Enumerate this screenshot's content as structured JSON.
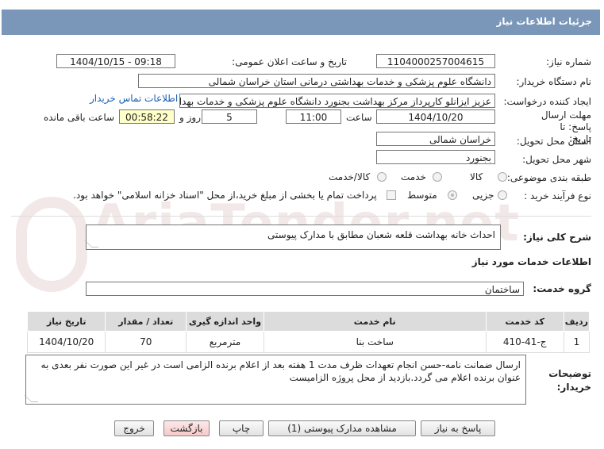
{
  "header": {
    "title": "جزئیات اطلاعات نیاز"
  },
  "fields": {
    "need_number_label": "شماره نیاز:",
    "need_number": "1104000257004615",
    "announce_label": "تاریخ و ساعت اعلان عمومی:",
    "announce_value": "1404/10/15 - 09:18",
    "buyer_label": "نام دستگاه خریدار:",
    "buyer_value": "دانشگاه علوم پزشکی و خدمات بهداشتی درمانی استان خراسان شمالی",
    "creator_label": "ایجاد کننده درخواست:",
    "creator_value": "عزیز ایزانلو کارپرداز مرکز بهداشت بجنورد دانشگاه علوم پزشکی و خدمات بهداشتی",
    "contact_link": "اطلاعات تماس خریدار",
    "deadline_label": "مهلت ارسال پاسخ: تا تاریخ:",
    "deadline_date": "1404/10/20",
    "time_label": "ساعت",
    "deadline_time": "11:00",
    "days_value": "5",
    "days_label": "روز و",
    "remaining_value": "00:58:22",
    "remaining_label": "ساعت باقی مانده",
    "province_label": "استان محل تحویل:",
    "province_value": "خراسان شمالی",
    "city_label": "شهر محل تحویل:",
    "city_value": "بجنورد",
    "category_label": "طبقه بندی موضوعی:",
    "category_options": [
      "کالا",
      "خدمت",
      "کالا/خدمت"
    ],
    "process_label": "نوع فرآیند خرید :",
    "process_options": [
      "جزیی",
      "متوسط"
    ],
    "payment_note": "پرداخت تمام یا بخشی از مبلغ خرید،از محل \"اسناد خزانه اسلامی\" خواهد بود."
  },
  "summary": {
    "label": "شرح کلی نیاز:",
    "value": "احداث خانه بهداشت قلعه شعبان مطابق با مدارک پیوستی"
  },
  "services_title": "اطلاعات خدمات مورد نیاز",
  "service_group": {
    "label": "گروه خدمت:",
    "value": "ساختمان"
  },
  "watermark": "AriaTender.net",
  "table": {
    "headers": [
      "ردیف",
      "کد خدمت",
      "نام خدمت",
      "واحد اندازه گیری",
      "تعداد / مقدار",
      "تاریخ نیاز"
    ],
    "rows": [
      [
        "1",
        "ج-41-410",
        "ساخت بنا",
        "مترمربع",
        "70",
        "1404/10/20"
      ]
    ]
  },
  "buyer_notes": {
    "label": "توضیحات خریدار:",
    "value": "ارسال ضمانت نامه-حسن انجام تعهدات ظرف مدت 1 هفته بعد از اعلام برنده الزامی است در غیر این صورت نفر بعدی به عنوان برنده اعلام می گردد.بازدید از محل پروژه الزامیست"
  },
  "buttons": {
    "reply": "پاسخ به نیاز",
    "attachments": "مشاهده مدارک پیوستی (1)",
    "print": "چاپ",
    "back": "بازگشت",
    "exit": "خروج"
  }
}
